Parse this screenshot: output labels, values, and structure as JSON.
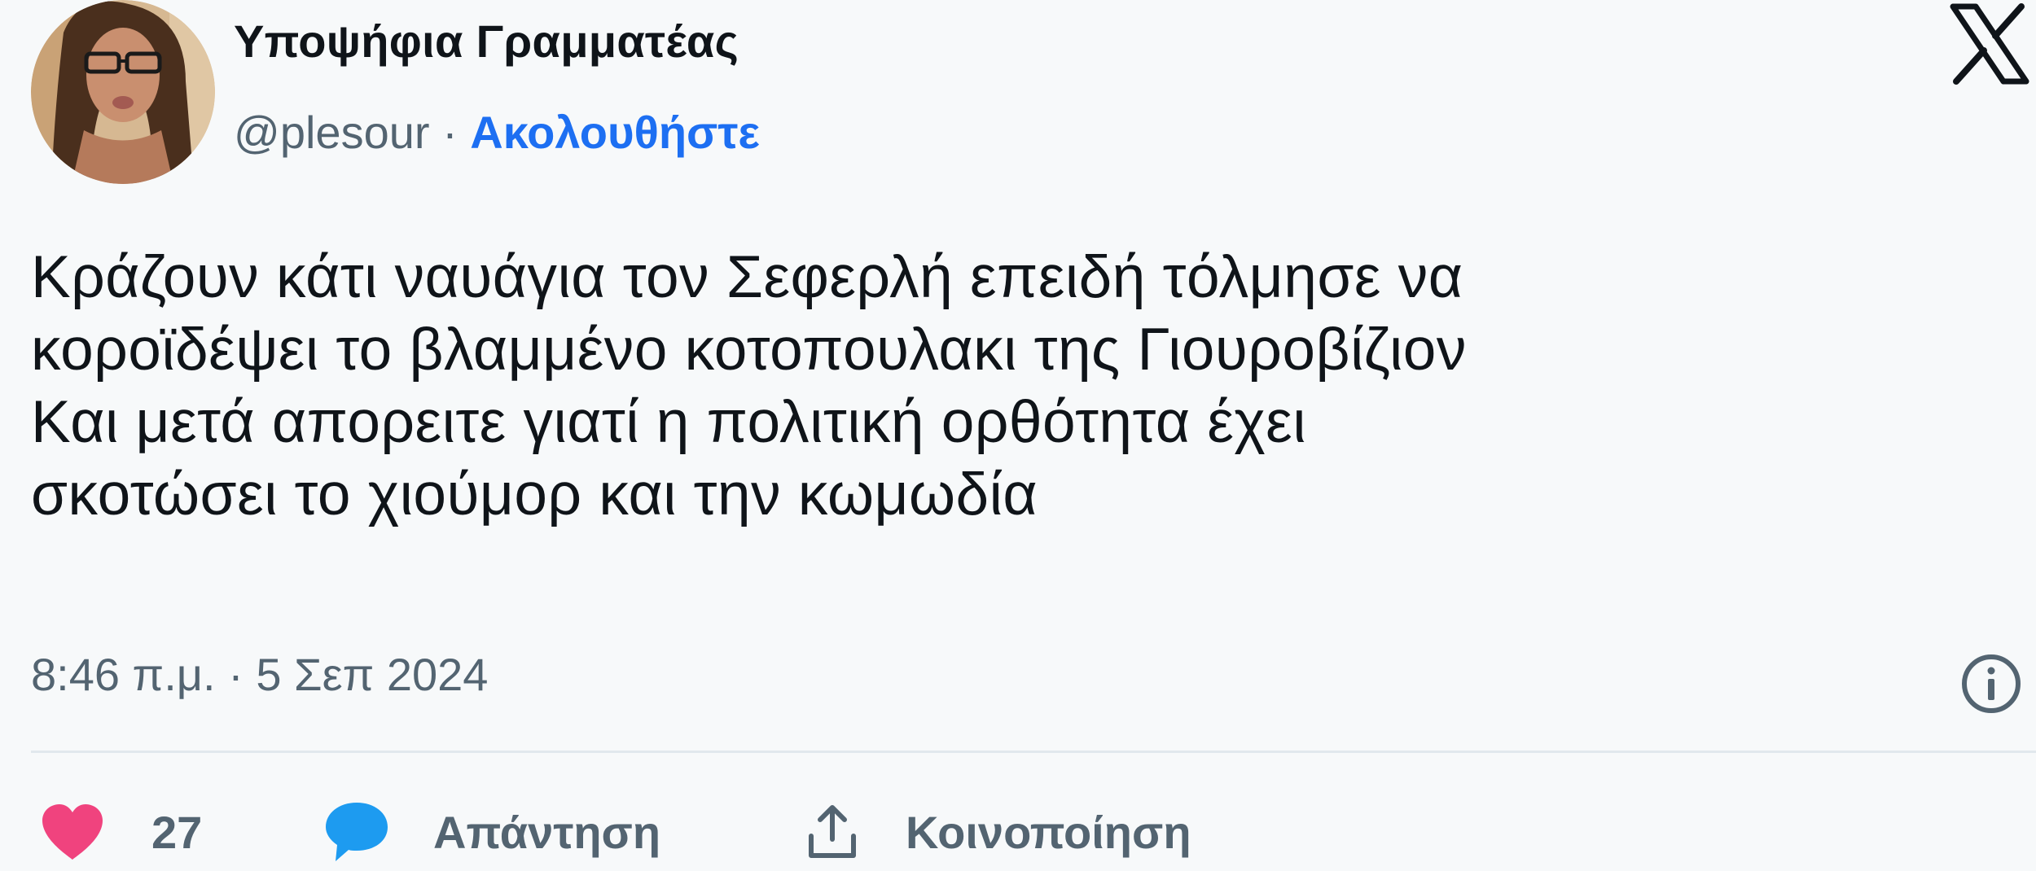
{
  "author": {
    "display_name": "Υποψήφια Γραμματέας",
    "handle": "@plesour",
    "separator": "·",
    "follow_label": "Ακολουθήστε"
  },
  "tweet": {
    "lines": [
      "Κράζουν κάτι ναυάγια τον Σεφερλή επειδή τόλμησε να",
      "κοροϊδέψει το βλαμμένο κοτοπουλακι της Γιουροβίζιον",
      "Και μετά απορειτε γιατί η πολιτική ορθότητα έχει",
      "σκοτώσει το χιούμορ και την κωμωδία"
    ],
    "timestamp": "8:46 π.μ. · 5 Σεπ 2024"
  },
  "actions": {
    "like_count": "27",
    "reply_label": "Απάντηση",
    "share_label": "Κοινοποίηση"
  },
  "icons": {
    "brand": "x-logo-icon",
    "info": "info-icon",
    "like": "heart-icon",
    "reply": "speech-bubble-icon",
    "share": "share-icon"
  },
  "colors": {
    "text": "#0f1419",
    "secondary": "#536471",
    "link": "#1d6ff2",
    "like": "#f0437e",
    "reply": "#1d9bf0",
    "card_background": "#f7f9fa"
  }
}
